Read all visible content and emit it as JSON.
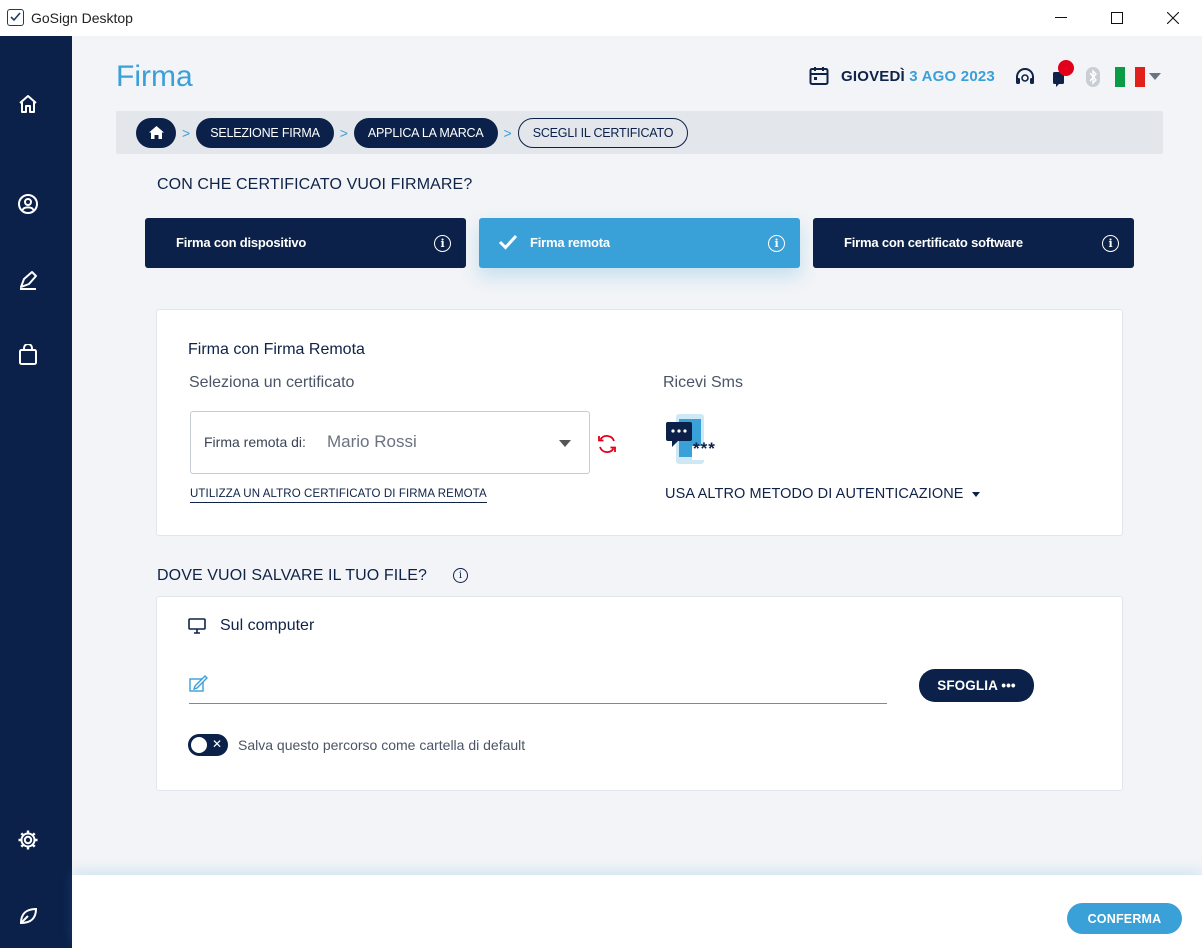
{
  "window": {
    "title": "GoSign Desktop",
    "controls": {
      "minimize": "—",
      "maximize": "☐",
      "close": "✕"
    }
  },
  "sidebar": {
    "items": [
      {
        "icon": "home-icon"
      },
      {
        "icon": "user-icon"
      },
      {
        "icon": "pen-icon"
      },
      {
        "icon": "bag-icon"
      },
      {
        "icon": "settings-icon"
      },
      {
        "icon": "leaf-icon"
      }
    ]
  },
  "header": {
    "title": "Firma",
    "date_day": "GIOVEDÌ",
    "date_rest": "3 AGO 2023"
  },
  "breadcrumb": {
    "items": [
      "SELEZIONE FIRMA",
      "APPLICA LA MARCA",
      "SCEGLI IL CERTIFICATO"
    ]
  },
  "cert_question": "CON CHE CERTIFICATO VUOI FIRMARE?",
  "cert_options": [
    {
      "label": "Firma con dispositivo",
      "selected": false
    },
    {
      "label": "Firma remota",
      "selected": true
    },
    {
      "label": "Firma con certificato software",
      "selected": false
    }
  ],
  "remote_panel": {
    "title": "Firma con Firma Remota",
    "select_certificate": "Seleziona un certificato",
    "select_label": "Firma remota di:",
    "select_value": "Mario Rossi",
    "alt_cert_link": "UTILIZZA UN ALTRO CERTIFICATO DI FIRMA REMOTA",
    "sms_label": "Ricevi Sms",
    "sms_stars": "***",
    "auth_method": "USA ALTRO METODO DI AUTENTICAZIONE"
  },
  "save_question": "DOVE VUOI SALVARE IL TUO FILE?",
  "save_panel": {
    "computer_label": "Sul computer",
    "path_value": "",
    "browse_button": "SFOGLIA •••",
    "toggle_label": "Salva questo percorso come cartella di default",
    "toggle_on": false
  },
  "footer": {
    "confirm_button": "CONFERMA"
  },
  "colors": {
    "navy": "#0b2149",
    "accent": "#3aa0d8",
    "notification": "#e3001b"
  }
}
